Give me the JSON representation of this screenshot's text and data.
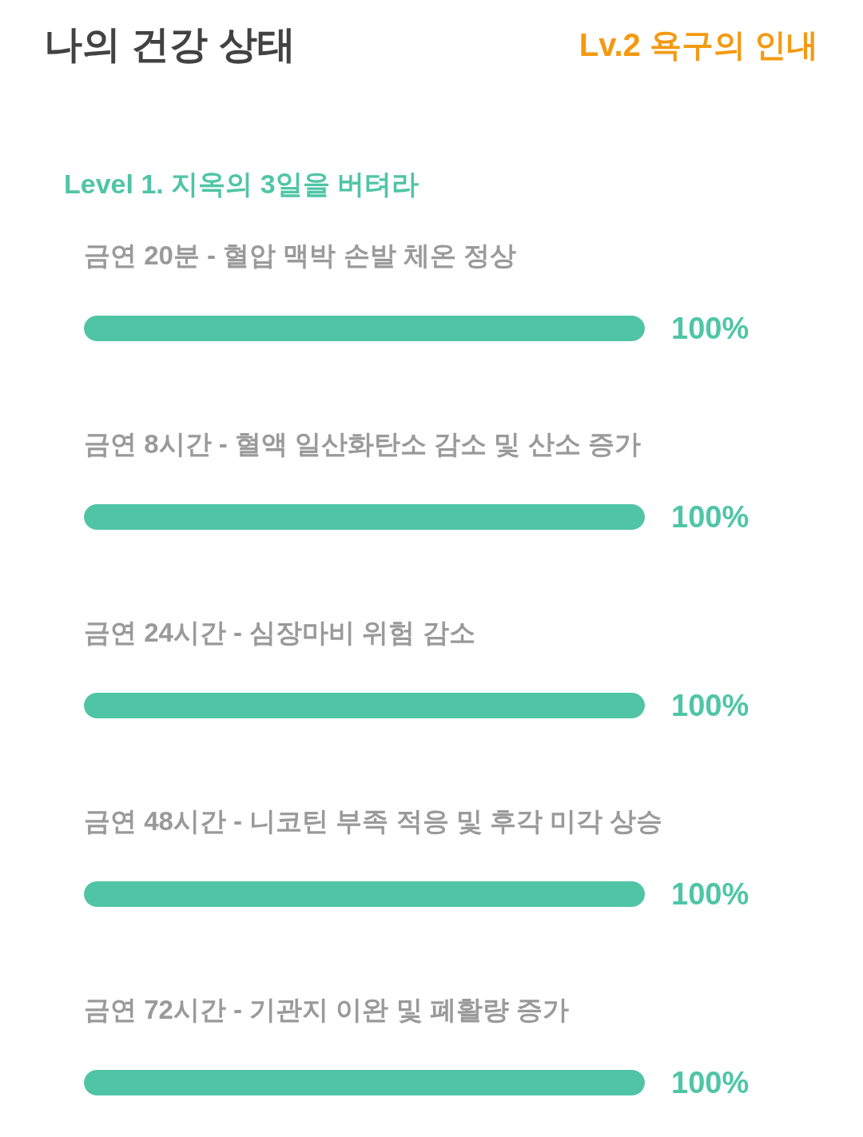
{
  "header": {
    "title": "나의 건강 상태",
    "level_badge": "Lv.2 욕구의 인내"
  },
  "section": {
    "title": "Level 1. 지옥의 3일을 버텨라",
    "milestones": [
      {
        "label": "금연 20분 - 혈압 맥박 손발 체온 정상",
        "level": 1,
        "reading": "100%"
      },
      {
        "label": "금연 8시간 - 혈액 일산화탄소 감소 및 산소 증가",
        "level": 1,
        "reading": "100%"
      },
      {
        "label": "금연 24시간 - 심장마비 위험 감소",
        "level": 1,
        "reading": "100%"
      },
      {
        "label": "금연 48시간 - 니코틴 부족 적응 및 후각 미각 상승",
        "level": 1,
        "reading": "100%"
      },
      {
        "label": "금연 72시간 - 기관지 이완 및 폐활량 증가",
        "level": 1,
        "reading": "100%"
      }
    ]
  }
}
